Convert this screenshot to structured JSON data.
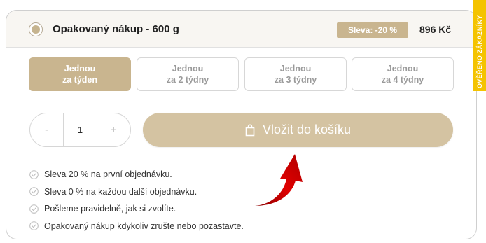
{
  "product": {
    "title": "Opakovaný nákup - 600 g",
    "discount_badge": "Sleva: -20 %",
    "price": "896 Kč"
  },
  "frequency": [
    {
      "line1": "Jednou",
      "line2": "za týden",
      "selected": true
    },
    {
      "line1": "Jednou",
      "line2": "za 2 týdny",
      "selected": false
    },
    {
      "line1": "Jednou",
      "line2": "za 3 týdny",
      "selected": false
    },
    {
      "line1": "Jednou",
      "line2": "za 4 týdny",
      "selected": false
    }
  ],
  "quantity": {
    "minus": "-",
    "value": "1",
    "plus": "+"
  },
  "cart_button": {
    "label": "Vložit do košíku",
    "icon": "shopping-bag-icon"
  },
  "benefits": [
    "Sleva 20 % na první objednávku.",
    "Sleva 0 % na každou další objednávku.",
    "Pošleme pravidelně, jak si zvolíte.",
    "Opakovaný nákup kdykoliv zrušte nebo pozastavte."
  ],
  "side_tab": {
    "label": "OVĚŘENO ZÁKAZNÍKY"
  },
  "colors": {
    "accent": "#c9b58f",
    "button": "#d4c3a2",
    "side_tab": "#f4c300",
    "arrow": "#d40000"
  }
}
